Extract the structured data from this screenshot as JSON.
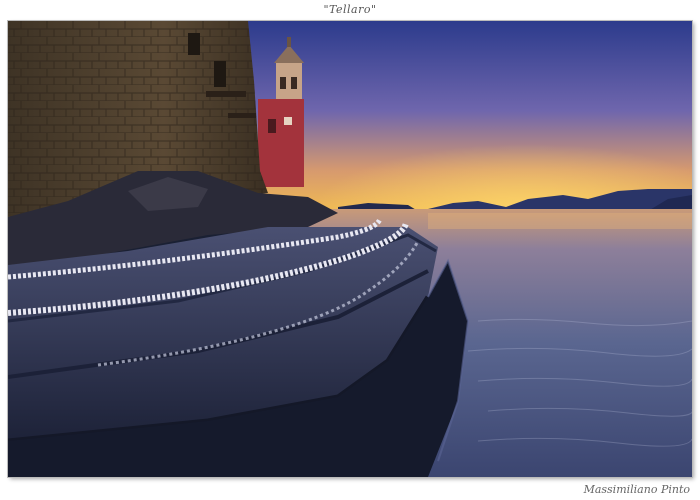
{
  "frame": {
    "title": "\"Tellaro\"",
    "signature": "Massimiliano Pinto"
  },
  "colors": {
    "sky_top": "#2e3d8a",
    "sky_mid": "#7a6aa8",
    "horizon_glow": "#f2b54a",
    "sea": "#5e6a93",
    "sea_highlight": "#d8a46a",
    "stone_wall": "#4a3c2c",
    "church_red": "#a8323a",
    "tower": "#c9a98a",
    "steps": "#3a4262",
    "mosaic_line": "#e8e8f0",
    "hills": "#2a3566"
  }
}
